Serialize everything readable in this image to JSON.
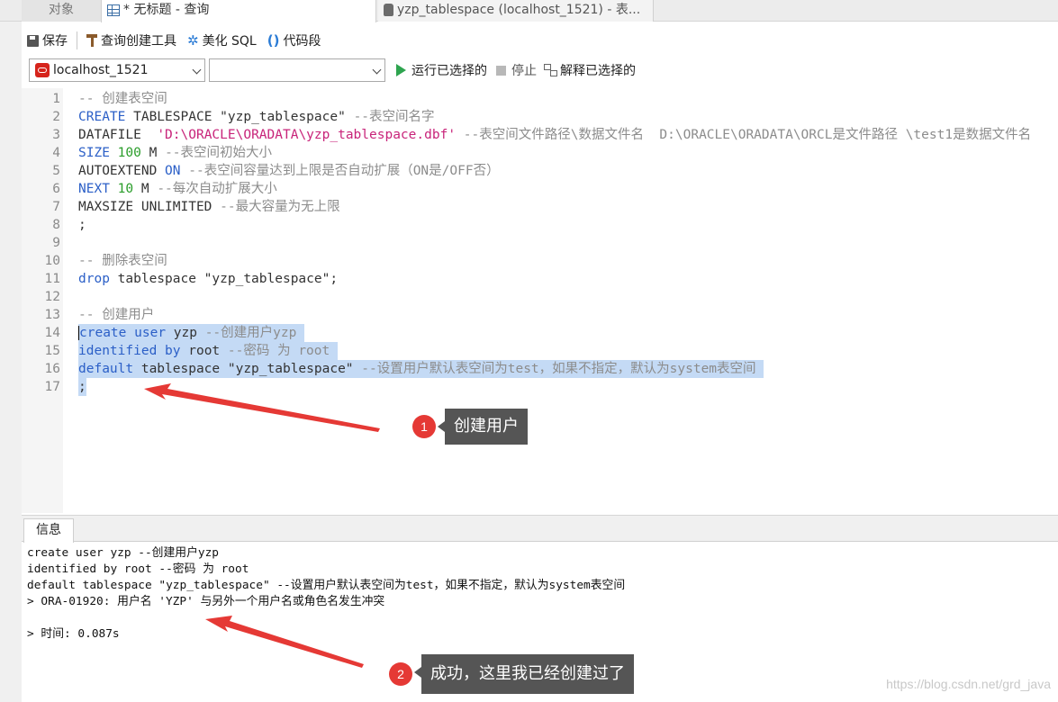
{
  "tabs": {
    "objects": "对象",
    "query": "* 无标题 - 查询",
    "table": "yzp_tablespace (localhost_1521) - 表..."
  },
  "toolbar": {
    "save": "保存",
    "query_builder": "查询创建工具",
    "beautify": "美化 SQL",
    "snippet": "代码段"
  },
  "connection": {
    "selected": "localhost_1521",
    "database": "",
    "run_selected": "运行已选择的",
    "stop": "停止",
    "explain_selected": "解释已选择的"
  },
  "editor": {
    "lines": [
      {
        "n": "1"
      },
      {
        "n": "2"
      },
      {
        "n": "3"
      },
      {
        "n": "4"
      },
      {
        "n": "5"
      },
      {
        "n": "6"
      },
      {
        "n": "7"
      },
      {
        "n": "8"
      },
      {
        "n": "9"
      },
      {
        "n": "10"
      },
      {
        "n": "11"
      },
      {
        "n": "12"
      },
      {
        "n": "13"
      },
      {
        "n": "14"
      },
      {
        "n": "15"
      },
      {
        "n": "16"
      },
      {
        "n": "17"
      }
    ],
    "code": {
      "l1": "-- 创建表空间",
      "l2_kw": "CREATE",
      "l2_rest": " TABLESPACE \"yzp_tablespace\" ",
      "l2_cm": "--表空间名字",
      "l3_a": "DATAFILE  ",
      "l3_str": "'D:\\ORACLE\\ORADATA\\yzp_tablespace.dbf'",
      "l3_cm": " --表空间文件路径\\数据文件名  D:\\ORACLE\\ORADATA\\ORCL是文件路径 \\test1是数据文件名",
      "l4_kw": "SIZE",
      "l4_num": "100",
      "l4_rest": " M ",
      "l4_cm": "--表空间初始大小",
      "l5_a": "AUTOEXTEND ",
      "l5_kw": "ON",
      "l5_cm": " --表空间容量达到上限是否自动扩展（ON是/OFF否）",
      "l6_kw": "NEXT",
      "l6_num": "10",
      "l6_rest": " M ",
      "l6_cm": "--每次自动扩展大小",
      "l7_a": "MAXSIZE UNLIMITED ",
      "l7_cm": "--最大容量为无上限",
      "l8": ";",
      "l10": "-- 删除表空间",
      "l11_kw": "drop",
      "l11_rest": " tablespace \"yzp_tablespace\";",
      "l13": "-- 创建用户",
      "l14_kw1": "create",
      "l14_kw2": "user",
      "l14_rest": " yzp ",
      "l14_cm": "--创建用户yzp ",
      "l15_kw1": "identified",
      "l15_kw2": "by",
      "l15_rest": " root ",
      "l15_cm": "--密码 为 root ",
      "l16_kw": "default",
      "l16_rest": " tablespace \"yzp_tablespace\" ",
      "l16_cm": "--设置用户默认表空间为test，如果不指定，默认为system表空间 ",
      "l17": ";"
    }
  },
  "panel": {
    "tab": "信息",
    "messages": [
      "create user yzp --创建用户yzp",
      "identified by root --密码 为 root",
      "default tablespace \"yzp_tablespace\" --设置用户默认表空间为test，如果不指定，默认为system表空间",
      "> ORA-01920: 用户名 'YZP' 与另外一个用户名或角色名发生冲突",
      "",
      "> 时间: 0.087s"
    ]
  },
  "annotations": {
    "badge1": "1",
    "label1": "创建用户",
    "badge2": "2",
    "label2": "成功，这里我已经创建过了",
    "color": "#e53935"
  },
  "watermark": "https://blog.csdn.net/grd_java",
  "colors": {
    "keyword": "#2b5fc7",
    "number": "#2a9d2a",
    "string": "#c8247a",
    "comment": "#8c8c8c",
    "selection": "#c4daf5"
  }
}
